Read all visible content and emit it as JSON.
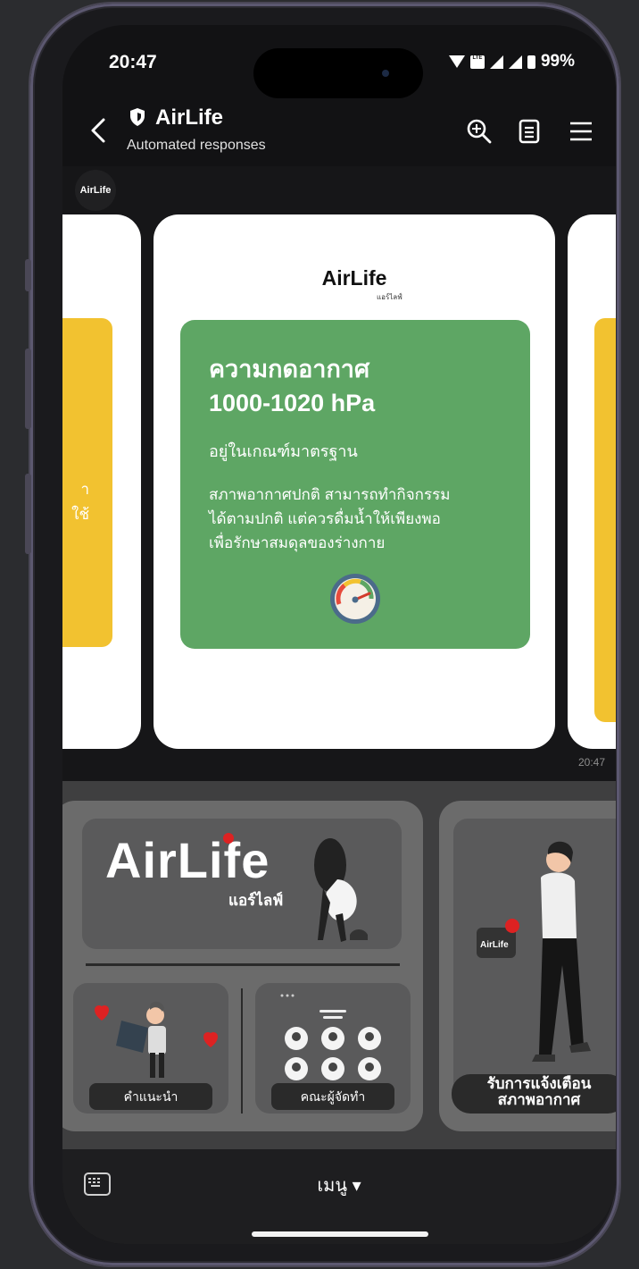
{
  "status_bar": {
    "time": "20:47",
    "battery": "99%"
  },
  "header": {
    "title": "AirLife",
    "subtitle": "Automated responses",
    "icons": [
      "back-arrow-icon",
      "shield-icon",
      "search-icon",
      "notes-icon",
      "menu-icon"
    ]
  },
  "chat": {
    "avatar_label": "AirLife",
    "brand_logo": "AirLife",
    "brand_sub": "แอร์ไลฟ์",
    "card": {
      "title_line1": "ความกดอากาศ",
      "title_line2": "1000-1020 hPa",
      "status": "อยู่ในเกณฑ์มาตรฐาน",
      "description_line1": "สภาพอากาศปกติ สามารถทำกิจกรรม",
      "description_line2": "ได้ตามปกติ แต่ควรดื่มน้ำให้เพียงพอ",
      "description_line3": "เพื่อรักษาสมดุลของร่างกาย"
    },
    "left_card_text_line1": "า",
    "left_card_text_line2": "ใช้",
    "message_time": "20:47",
    "colors": {
      "green": "#5ea664",
      "yellow": "#f2c230"
    }
  },
  "rich_menu": {
    "logo": "AirLife",
    "logo_thai": "แอร์ไลฟ์",
    "phone_logo": "AirLife",
    "items": [
      {
        "label": "คำแนะนำ"
      },
      {
        "label": "คณะผู้จัดทำ"
      },
      {
        "label_line1": "รับการแจ้งเตือน",
        "label_line2": "สภาพอากาศ"
      }
    ]
  },
  "bottom_bar": {
    "menu_label": "เมนู ▾"
  }
}
